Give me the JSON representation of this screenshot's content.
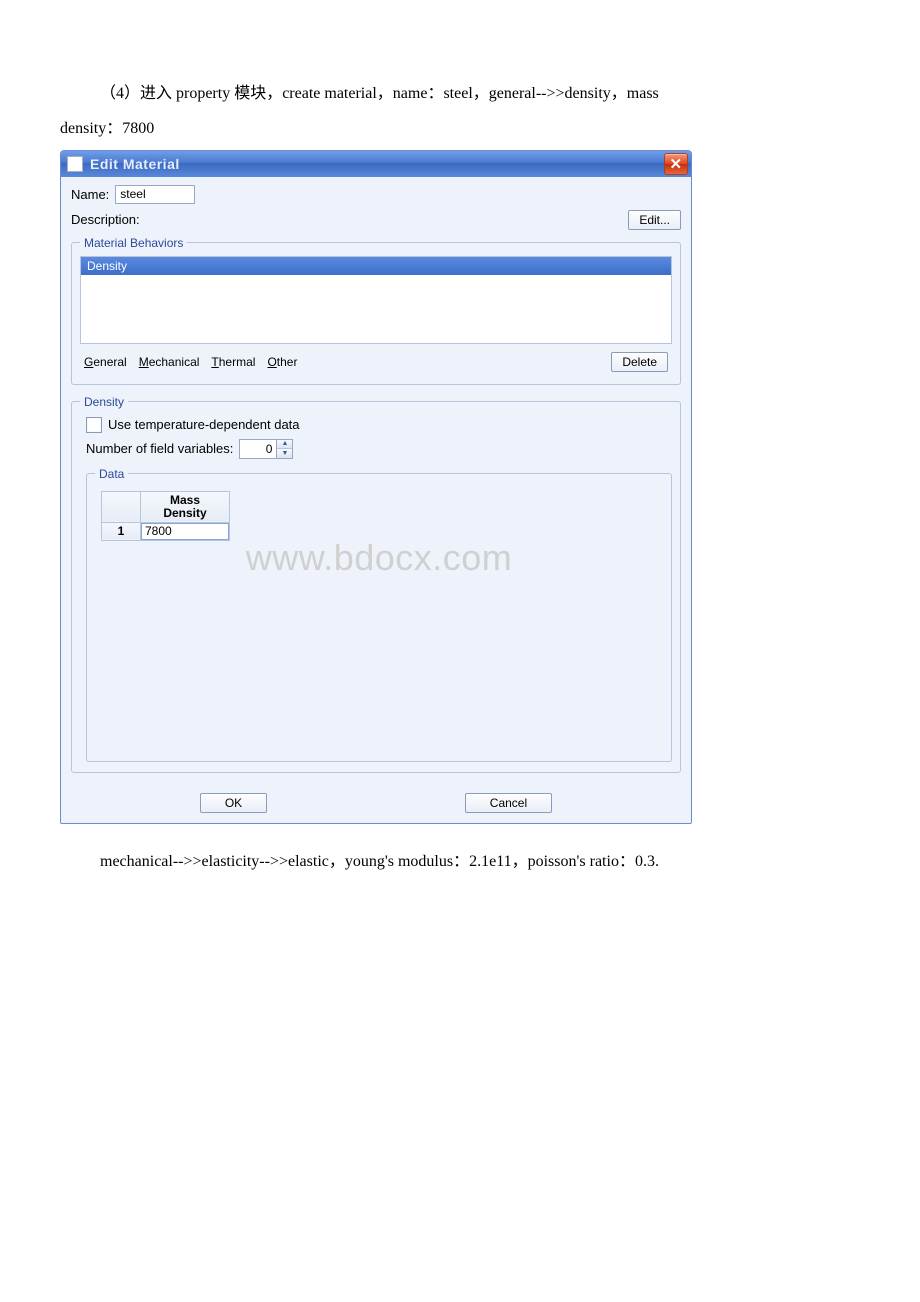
{
  "intro": {
    "line1": "（4）进入 property 模块，create material，name：steel，general-->>density，mass",
    "line2": "density：7800"
  },
  "dialog": {
    "title": "Edit Material",
    "name_label": "Name:",
    "name_value": "steel",
    "desc_label": "Description:",
    "edit_button": "Edit...",
    "behaviors_legend": "Material Behaviors",
    "behavior_selected": "Density",
    "menu": {
      "general": "General",
      "mechanical": "Mechanical",
      "thermal": "Thermal",
      "other": "Other"
    },
    "delete_button": "Delete",
    "density_legend": "Density",
    "temp_check_label": "Use temperature-dependent data",
    "field_vars_label": "Number of field variables:",
    "field_vars_value": "0",
    "data_legend": "Data",
    "column_header_l1": "Mass",
    "column_header_l2": "Density",
    "row_number": "1",
    "mass_density_value": "7800",
    "ok_button": "OK",
    "cancel_button": "Cancel"
  },
  "watermark": "www.bdocx.com",
  "outro": "mechanical-->>elasticity-->>elastic，young's modulus：2.1e11，poisson's ratio：0.3."
}
